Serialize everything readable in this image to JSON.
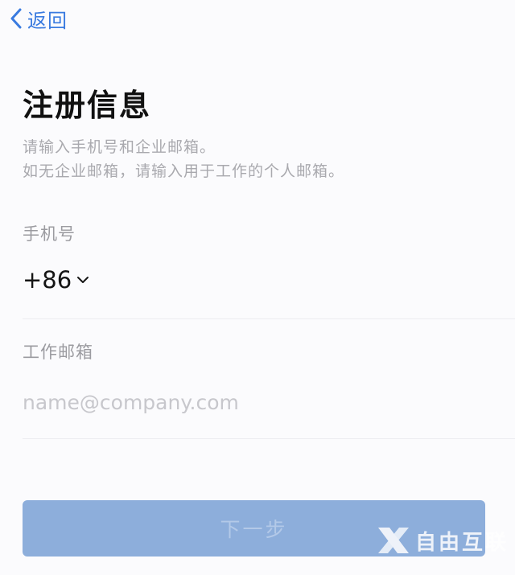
{
  "nav": {
    "back_label": "返回"
  },
  "header": {
    "title": "注册信息",
    "description_line1": "请输入手机号和企业邮箱。",
    "description_line2": "如无企业邮箱，请输入用于工作的个人邮箱。"
  },
  "form": {
    "phone_label": "手机号",
    "country_code": "+86",
    "email_label": "工作邮箱",
    "email_value": "",
    "email_placeholder": "name@company.com"
  },
  "actions": {
    "next_label": "下一步"
  },
  "watermark": {
    "text": "自由互联"
  },
  "colors": {
    "accent": "#3a7be0",
    "button_disabled_bg": "#8daedb",
    "button_disabled_text": "#b3c9e8"
  }
}
